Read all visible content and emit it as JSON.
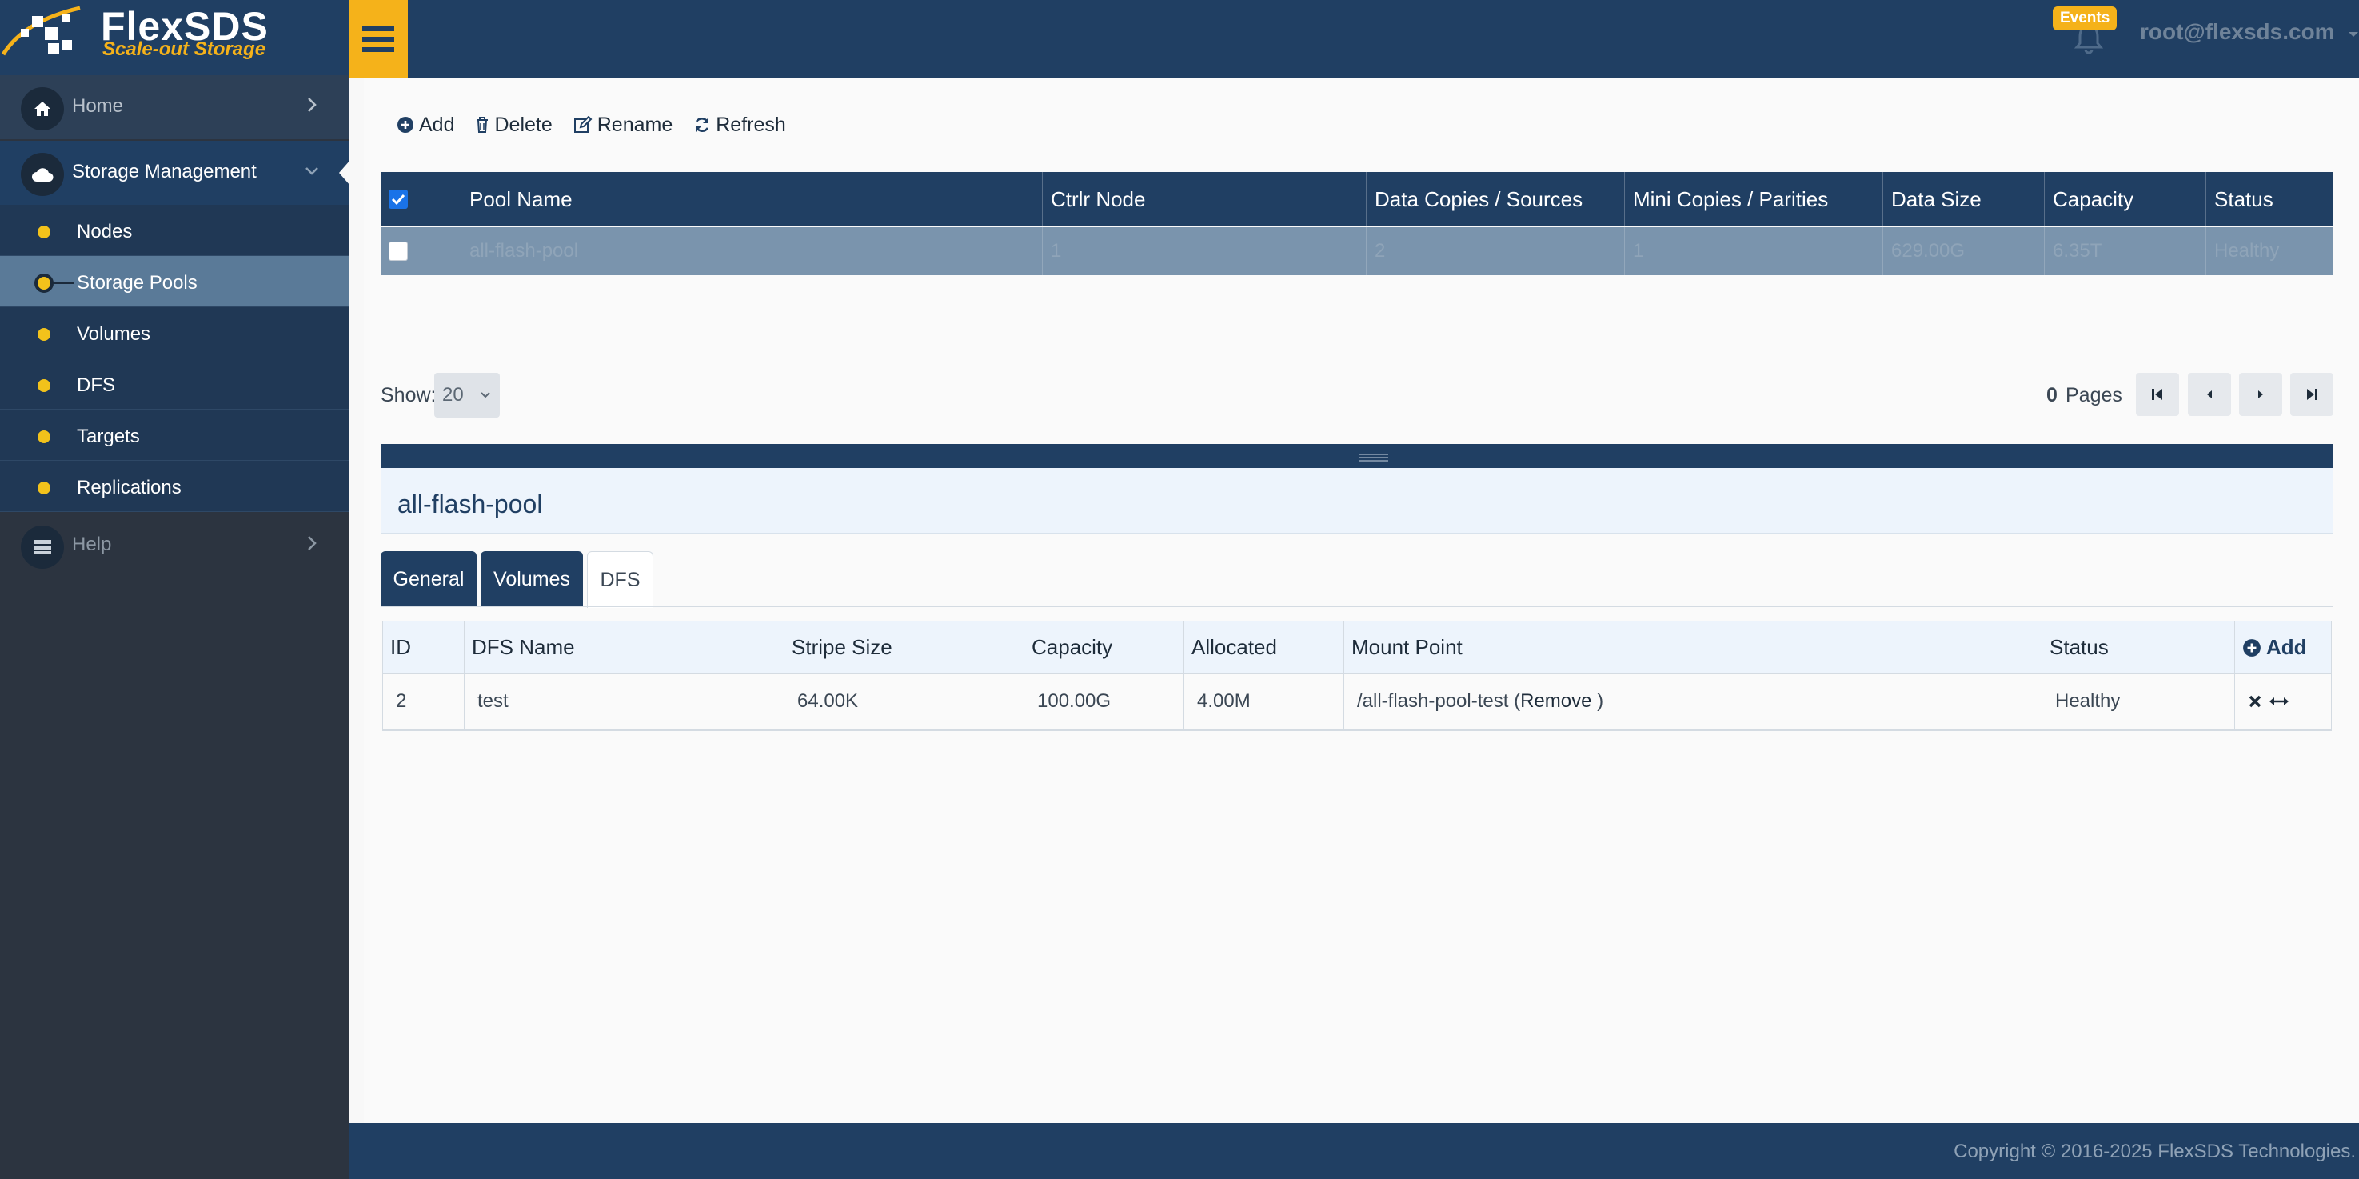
{
  "brand": {
    "name": "FlexSDS",
    "tagline": "Scale-out Storage"
  },
  "topbar": {
    "events_label": "Events",
    "user": "root@flexsds.com"
  },
  "sidebar": {
    "home": "Home",
    "storage_management": "Storage Management",
    "sub_items": [
      "Nodes",
      "Storage Pools",
      "Volumes",
      "DFS",
      "Targets",
      "Replications"
    ],
    "active_sub_item": "Storage Pools",
    "help": "Help"
  },
  "toolbar": {
    "add": "Add",
    "delete": "Delete",
    "rename": "Rename",
    "refresh": "Refresh"
  },
  "pools_table": {
    "columns": [
      "Pool Name",
      "Ctrlr Node",
      "Data Copies / Sources",
      "Mini Copies / Parities",
      "Data Size",
      "Capacity",
      "Status"
    ],
    "rows": [
      {
        "selected": false,
        "cells": [
          "all-flash-pool",
          "1",
          "2",
          "1",
          "629.00G",
          "6.35T",
          "Healthy"
        ]
      }
    ],
    "header_checked": true
  },
  "pager": {
    "show_label": "Show:",
    "page_size": "20",
    "page_count": "0",
    "pages_label": "Pages"
  },
  "detail": {
    "title": "all-flash-pool",
    "tabs": [
      "General",
      "Volumes",
      "DFS"
    ],
    "active_tab": "DFS"
  },
  "dfs_table": {
    "columns": [
      "ID",
      "DFS Name",
      "Stripe Size",
      "Capacity",
      "Allocated",
      "Mount Point",
      "Status"
    ],
    "add_label": "Add",
    "rows": [
      {
        "cells": [
          "2",
          "test",
          "64.00K",
          "100.00G",
          "4.00M"
        ],
        "mount_point": "/all-flash-pool-test",
        "remove_label": "Remove",
        "status": "Healthy"
      }
    ]
  },
  "footer": {
    "copyright": "Copyright © 2016-2025 FlexSDS Technologies."
  },
  "colors": {
    "navy": "#203f63",
    "accent": "#f5b21a",
    "sidebar": "#2c3440",
    "selected_row": "#7a94ad",
    "checkbox": "#1a73e8"
  }
}
